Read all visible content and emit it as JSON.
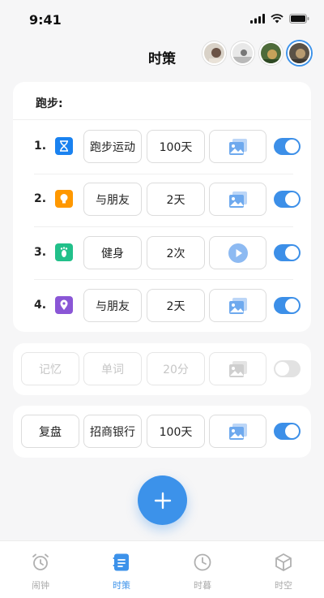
{
  "status": {
    "time": "9:41"
  },
  "header": {
    "title": "时策"
  },
  "card1": {
    "title": "跑步:",
    "rows": [
      {
        "num": "1.",
        "icon": "hourglass-icon",
        "icon_color": "#1a82f0",
        "name": "跑步运动",
        "value": "100天",
        "media": "image-icon",
        "enabled": true
      },
      {
        "num": "2.",
        "icon": "lightbulb-icon",
        "icon_color": "#ff9800",
        "name": "与朋友",
        "value": "2天",
        "media": "image-icon",
        "enabled": true
      },
      {
        "num": "3.",
        "icon": "footprint-icon",
        "icon_color": "#22c08a",
        "name": "健身",
        "value": "2次",
        "media": "play-icon",
        "enabled": true
      },
      {
        "num": "4.",
        "icon": "location-pin-icon",
        "icon_color": "#8a56d6",
        "name": "与朋友",
        "value": "2天",
        "media": "image-icon",
        "enabled": true
      }
    ]
  },
  "card2": {
    "a": "记忆",
    "b": "单词",
    "c": "20分",
    "enabled": false
  },
  "card3": {
    "a": "复盘",
    "b": "招商银行",
    "c": "100天",
    "enabled": true
  },
  "tabs": [
    {
      "label": "闹钟",
      "icon": "alarm-clock-icon",
      "active": false
    },
    {
      "label": "时策",
      "icon": "document-icon",
      "active": true
    },
    {
      "label": "时暮",
      "icon": "clock-icon",
      "active": false
    },
    {
      "label": "时空",
      "icon": "cube-icon",
      "active": false
    }
  ],
  "colors": {
    "accent": "#3c92ea",
    "disabled": "#c6c6c6"
  }
}
